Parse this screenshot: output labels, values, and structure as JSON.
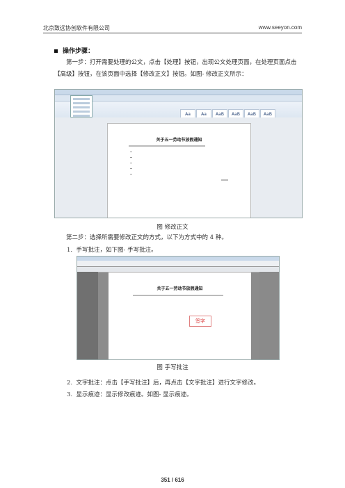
{
  "header": {
    "company": "北京致远协创软件有限公司",
    "website": "www.seeyon.com"
  },
  "section_title": "操作步骤：",
  "step1": "第一步：打开需要处理的公文，点击【处理】按钮，出现公文处理页面，在处理页面点击【高级】按钮，在该页面中选择【修改正文】按钮。如图- 修改正文所示：",
  "fig1": {
    "caption": "图  修改正文",
    "doc_title": "关于五一劳动节放假通知"
  },
  "step2": "第二步：选择所需要修改正文的方式，以下为方式中的 4 种。",
  "item1": {
    "num": "1.",
    "text": "手写批注，如下图- 手写批注。"
  },
  "fig2": {
    "caption": "图  手写批注",
    "doc_title": "关于五一劳动节放假通知",
    "stamp": "签字"
  },
  "item2": {
    "num": "2.",
    "text": "文字批注：点击【手写批注】后，再点击【文字批注】进行文字修改。"
  },
  "item3": {
    "num": "3.",
    "text": "显示痕迹：显示修改痕迹。如图- 显示痕迹。"
  },
  "footer": {
    "page": "351 / 616"
  }
}
